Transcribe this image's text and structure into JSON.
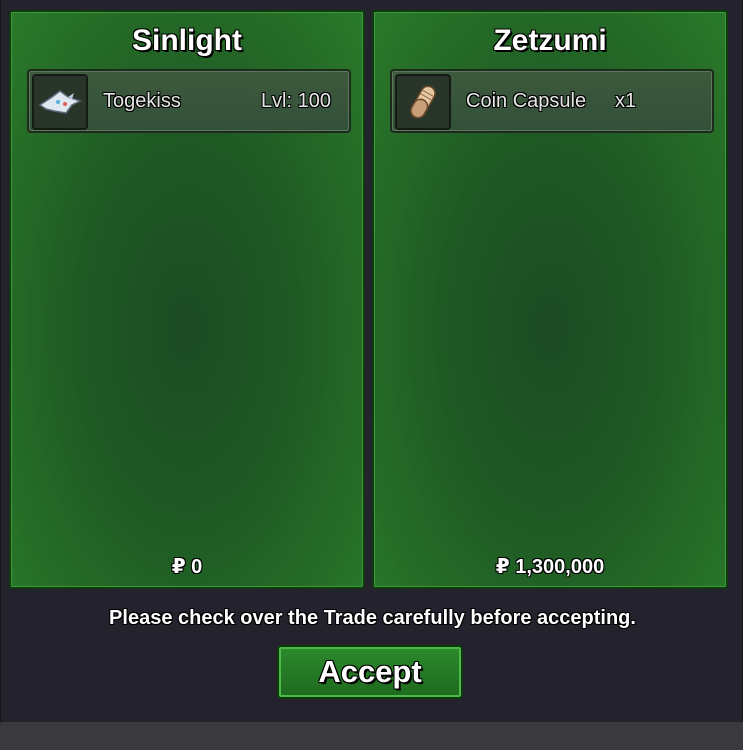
{
  "trade": {
    "left": {
      "player_name": "Sinlight",
      "item": {
        "name": "Togekiss",
        "level_text": "Lvl: 100",
        "icon": "togekiss-sprite-icon"
      },
      "money": "₽ 0"
    },
    "right": {
      "player_name": "Zetzumi",
      "item": {
        "name": "Coin Capsule",
        "quantity": "x1",
        "icon": "coin-capsule-icon"
      },
      "money": "₽ 1,300,000"
    },
    "notice": "Please check over the Trade carefully before accepting.",
    "accept_label": "Accept"
  },
  "colors": {
    "panel_green": "#1f5a24",
    "accept_green": "#2c8a2c",
    "window_bg": "#24232d"
  }
}
